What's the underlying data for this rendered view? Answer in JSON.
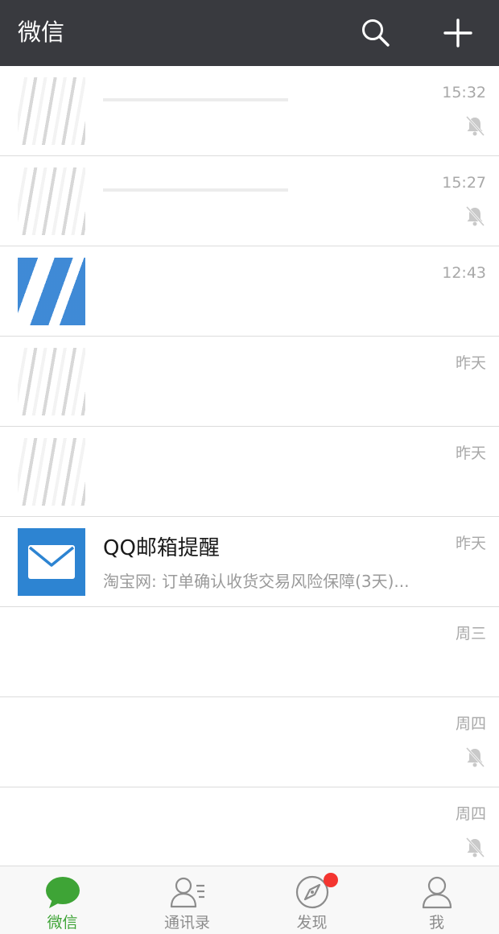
{
  "header": {
    "title": "微信",
    "search_icon": "search-icon",
    "add_icon": "plus-icon",
    "background": "#393a3f"
  },
  "chats": [
    {
      "name": "",
      "preview": "",
      "time": "15:32",
      "muted": true,
      "avatar": "blurred"
    },
    {
      "name": "",
      "preview": "",
      "time": "15:27",
      "muted": true,
      "avatar": "blurred"
    },
    {
      "name": "",
      "preview": "",
      "time": "12:43",
      "muted": false,
      "avatar": "blue-blur"
    },
    {
      "name": "",
      "preview": "",
      "time": "昨天",
      "muted": false,
      "avatar": "blurred"
    },
    {
      "name": "",
      "preview": "",
      "time": "昨天",
      "muted": false,
      "avatar": "blurred"
    },
    {
      "name": "QQ邮箱提醒",
      "preview": "淘宝网: 订单确认收货交易风险保障(3天)...",
      "time": "昨天",
      "muted": false,
      "avatar": "mail"
    },
    {
      "name": "",
      "preview": "",
      "time": "周三",
      "muted": false,
      "avatar": "hidden"
    },
    {
      "name": "",
      "preview": "",
      "time": "周四",
      "muted": true,
      "avatar": "hidden"
    },
    {
      "name": "",
      "preview": "",
      "time": "周四",
      "muted": true,
      "avatar": "hidden"
    }
  ],
  "tabbar": {
    "tabs": [
      {
        "label": "微信",
        "icon": "chat-bubble-icon",
        "active": true
      },
      {
        "label": "通讯录",
        "icon": "contacts-icon",
        "active": false
      },
      {
        "label": "发现",
        "icon": "compass-icon",
        "active": false,
        "badge": true
      },
      {
        "label": "我",
        "icon": "profile-icon",
        "active": false
      }
    ],
    "active_color": "#3ea436",
    "badge_color": "#f43530"
  }
}
